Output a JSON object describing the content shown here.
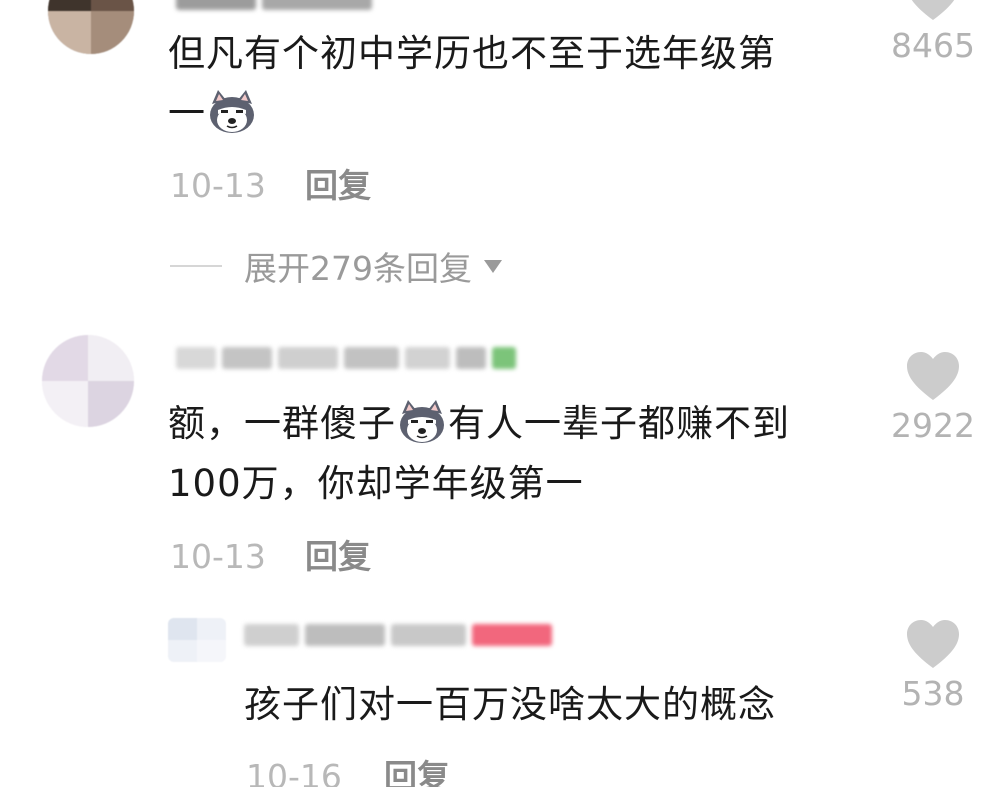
{
  "comments": [
    {
      "text_line1": "但凡有个初中学历也不至于选年级第",
      "text_line2": "一",
      "date": "10-13",
      "reply_label": "回复",
      "like_count": "8465",
      "emoji": "husky-emoji"
    },
    {
      "text_line1_a": "额，一群傻子",
      "text_line1_b": "有人一辈子都赚不到",
      "text_line2": "100万，你却学年级第一",
      "date": "10-13",
      "reply_label": "回复",
      "like_count": "2922",
      "emoji": "husky-emoji"
    },
    {
      "text_line1": "孩子们对一百万没啥太大的概念",
      "date": "10-16",
      "reply_label": "回复",
      "like_count": "538"
    }
  ],
  "expand_replies_label": "展开279条回复",
  "colors": {
    "text": "#1a1a1a",
    "meta": "#b8b8b8",
    "reply": "#8a8a8a",
    "heart": "#cccccc"
  },
  "icons": [
    "heart-icon",
    "husky-emoji",
    "caret-down-icon"
  ]
}
